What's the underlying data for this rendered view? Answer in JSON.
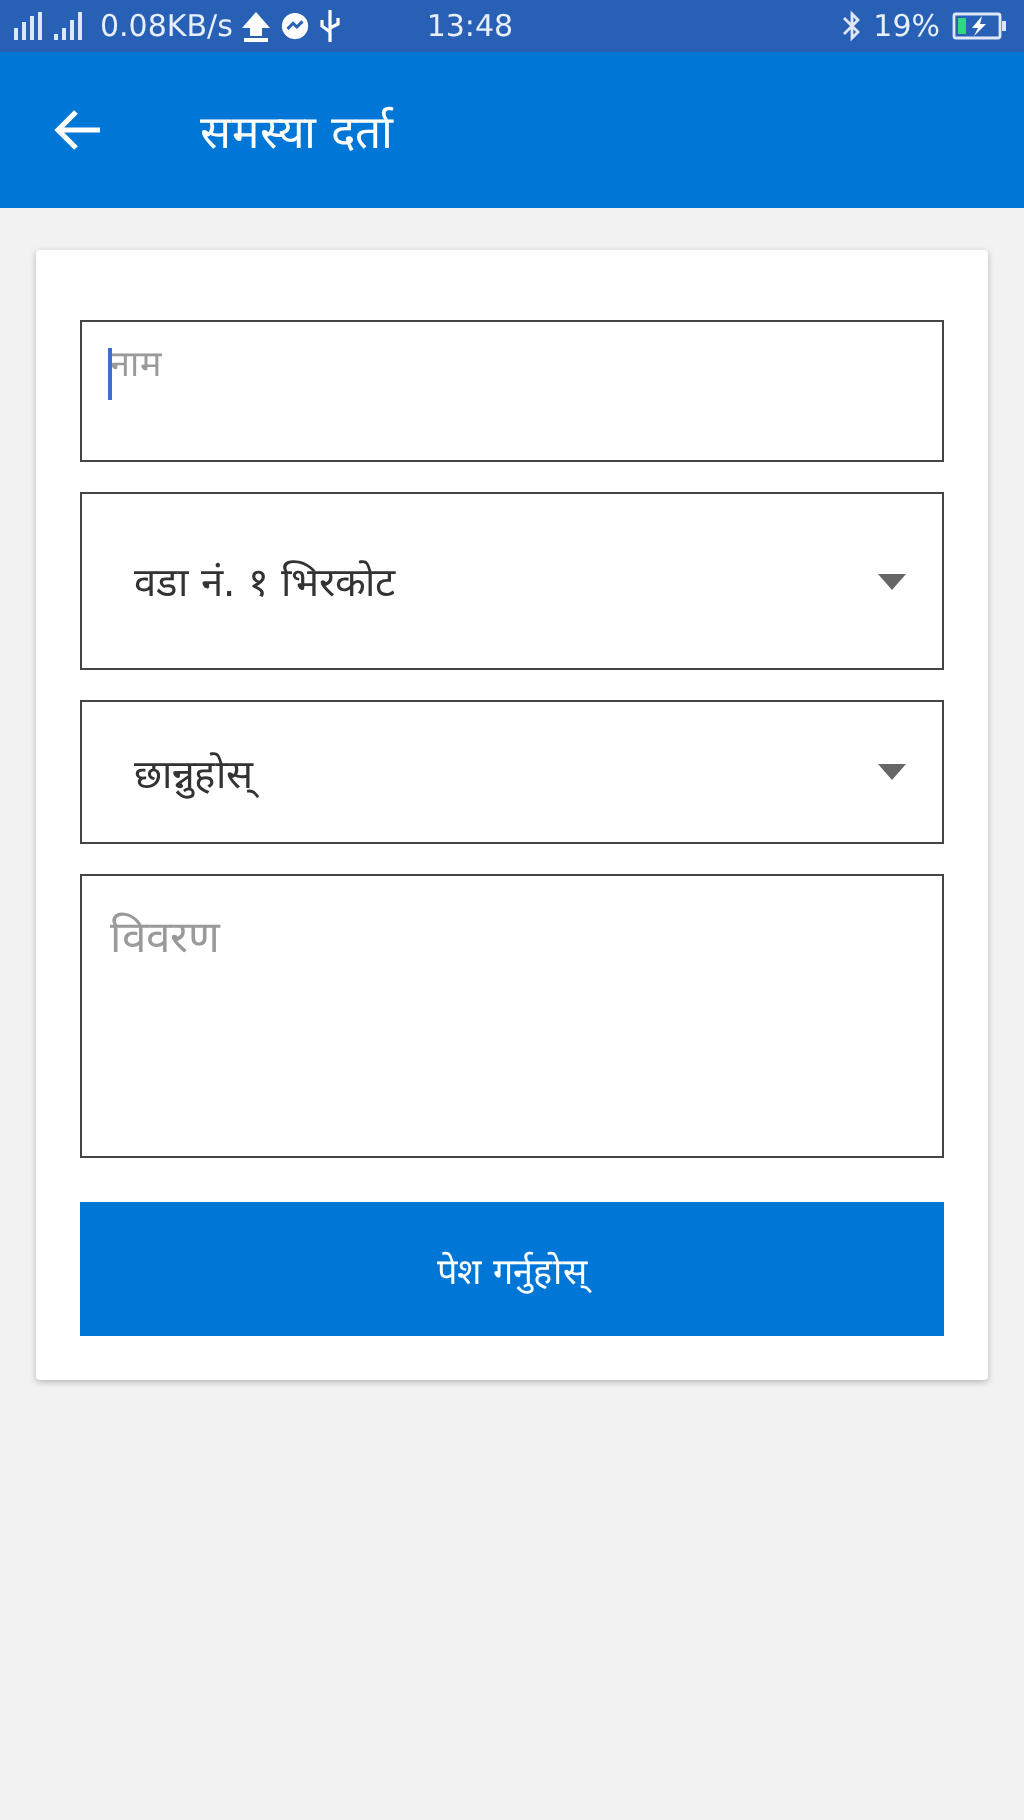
{
  "status_bar": {
    "network_speed": "0.08KB/s",
    "time": "13:48",
    "battery": "19%"
  },
  "app_bar": {
    "title": "समस्या दर्ता"
  },
  "form": {
    "fields": [
      {
        "kind": "text",
        "placeholder": "नाम",
        "focused": true
      },
      {
        "kind": "select",
        "value": "वडा नं. १ भिरकोट"
      },
      {
        "kind": "select",
        "value": "छान्नुहोस्"
      },
      {
        "kind": "textarea",
        "placeholder": "विवरण"
      }
    ],
    "submit": "पेश गर्नुहोस्"
  }
}
